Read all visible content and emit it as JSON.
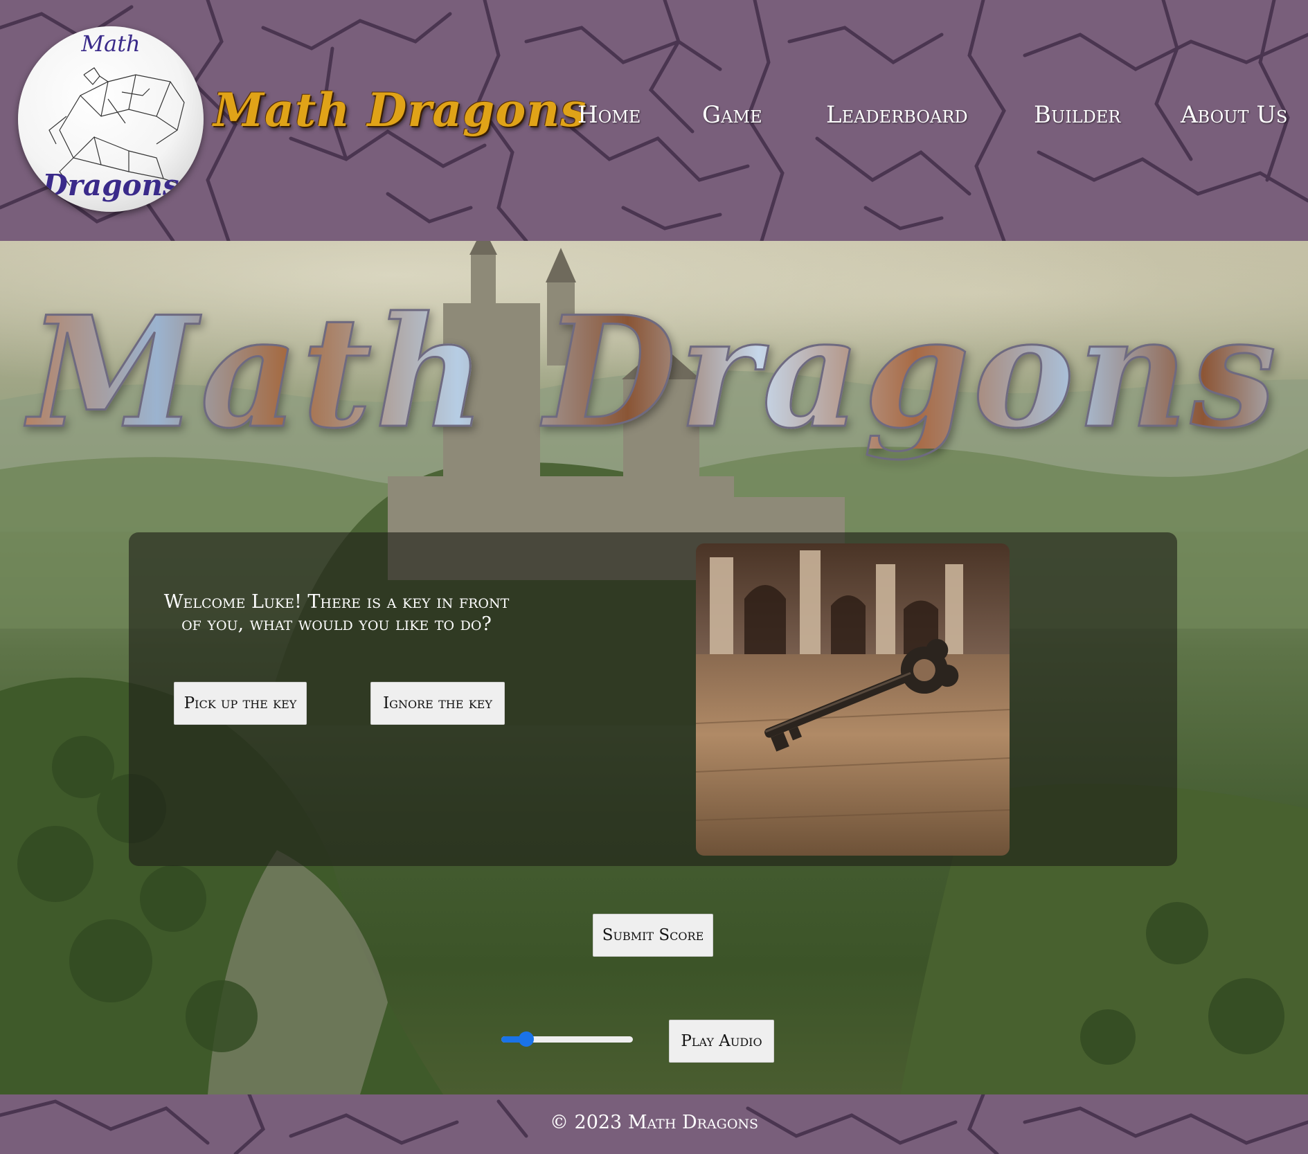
{
  "header": {
    "logo_text_top": "Math",
    "logo_text_bottom": "Dragons",
    "brand": "Math Dragons",
    "nav": [
      {
        "label": "Home"
      },
      {
        "label": "Game"
      },
      {
        "label": "Leaderboard"
      },
      {
        "label": "Builder"
      },
      {
        "label": "About Us"
      }
    ]
  },
  "hero": {
    "title": "Math Dragons"
  },
  "story": {
    "prompt": "Welcome Luke! There is a key in front of you, what would you like to do?",
    "choices": [
      {
        "label": "Pick up the key"
      },
      {
        "label": "Ignore the key"
      }
    ],
    "image_subject": "key-on-table"
  },
  "actions": {
    "submit_label": "Submit Score",
    "play_audio_label": "Play Audio",
    "volume_level": 0.15
  },
  "footer": {
    "copyright": "© 2023 Math Dragons"
  },
  "colors": {
    "header_bg": "#795f7b",
    "crack": "#4a3550",
    "brand_gold": "#e0a318",
    "slider_accent": "#1a73e8",
    "button_bg": "#efefef"
  }
}
